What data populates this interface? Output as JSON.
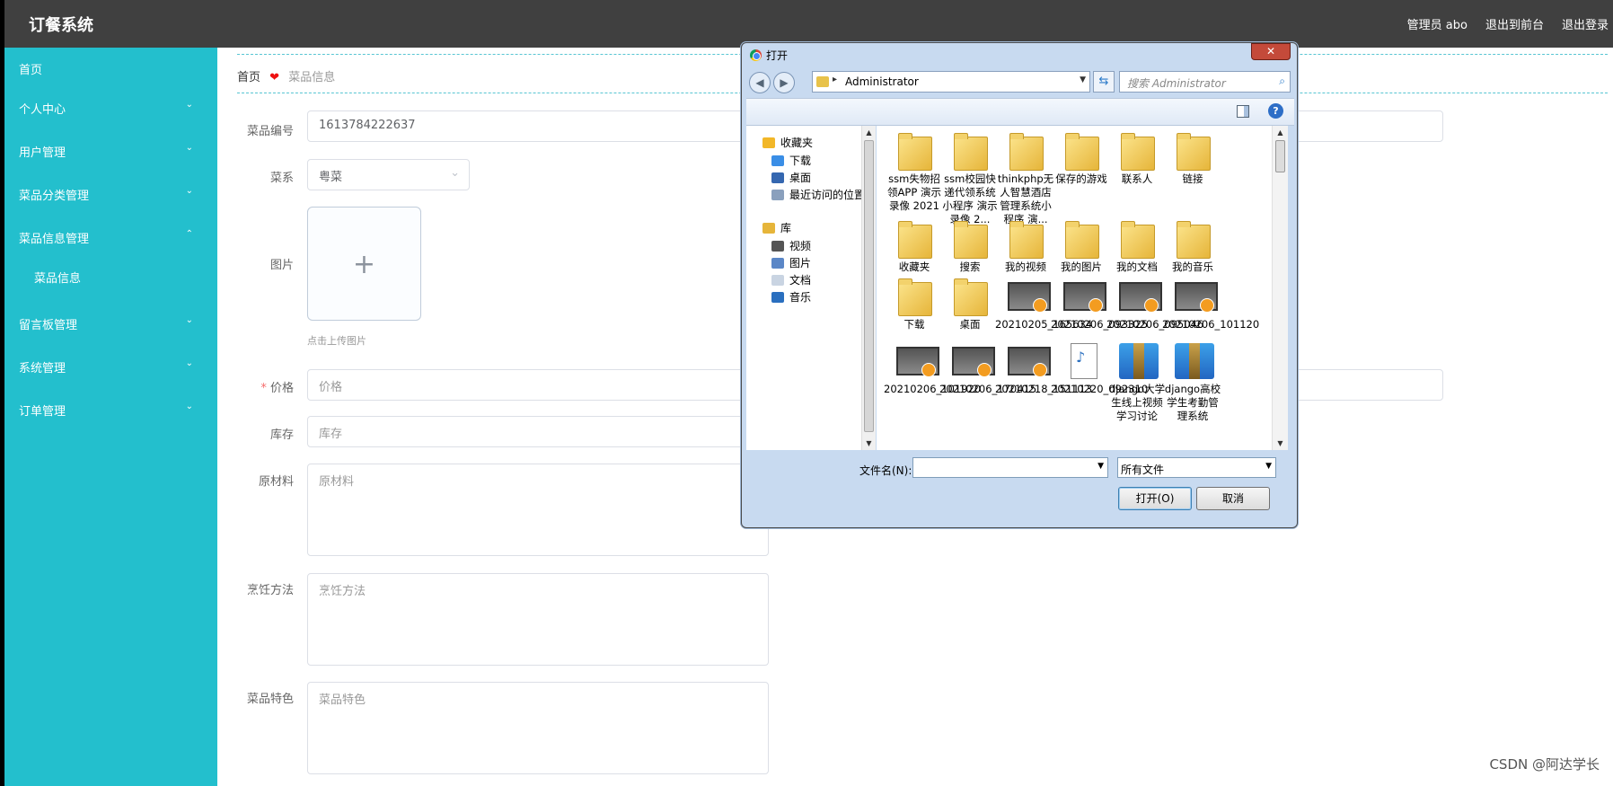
{
  "app": {
    "brand": "订餐系统",
    "topnav": [
      "管理员 abo",
      "退出到前台",
      "退出登录"
    ]
  },
  "sidebar": {
    "items": [
      {
        "label": "首页",
        "chevron": ""
      },
      {
        "label": "个人中心",
        "chevron": "⌄"
      },
      {
        "label": "用户管理",
        "chevron": "⌄"
      },
      {
        "label": "菜品分类管理",
        "chevron": "⌄"
      },
      {
        "label": "菜品信息管理",
        "chevron": "⌃"
      },
      {
        "label": "菜品信息",
        "chevron": ""
      },
      {
        "label": "留言板管理",
        "chevron": "⌄"
      },
      {
        "label": "系统管理",
        "chevron": "⌄"
      },
      {
        "label": "订单管理",
        "chevron": "⌄"
      }
    ]
  },
  "breadcrumb": {
    "home": "首页",
    "sep": "❤",
    "current": "菜品信息"
  },
  "form": {
    "code_label": "菜品编号",
    "code_value": "1613784222637",
    "cuisine_label": "菜系",
    "cuisine_value": "粤菜",
    "cuisine_dd": "⌄",
    "image_label": "图片",
    "upload_plus": "+",
    "upload_hint": "点击上传图片",
    "price_req": "*",
    "price_label": "价格",
    "price_placeholder": "价格",
    "stock_label": "库存",
    "stock_placeholder": "库存",
    "material_label": "原材料",
    "material_placeholder": "原材料",
    "method_label": "烹饪方法",
    "method_placeholder": "烹饪方法",
    "feature_label": "菜品特色",
    "feature_placeholder": "菜品特色"
  },
  "watermark": "CSDN @阿达学长",
  "dialog": {
    "title": "打开",
    "close": "✕",
    "back": "◀",
    "forward": "▶",
    "address": "Administrator",
    "address_arrow": "▸",
    "dropdown": "▼",
    "refresh": "⇆",
    "search_placeholder": "搜索 Administrator",
    "search_icon": "⌕",
    "help": "?",
    "scroll_up": "▲",
    "scroll_down": "▼",
    "nav": [
      {
        "label": "收藏夹",
        "icon": "star-icon",
        "color": "#f2b728"
      },
      {
        "label": "下载",
        "icon": "download-folder-icon",
        "color": "#3a8ee6"
      },
      {
        "label": "桌面",
        "icon": "desktop-icon",
        "color": "#3567b0"
      },
      {
        "label": "最近访问的位置",
        "icon": "recent-places-icon",
        "color": "#8aa0bd"
      },
      {
        "label": "库",
        "icon": "library-icon",
        "color": "#e6b53a"
      },
      {
        "label": "视频",
        "icon": "video-library-icon",
        "color": "#555555"
      },
      {
        "label": "图片",
        "icon": "pictures-library-icon",
        "color": "#5b87c7"
      },
      {
        "label": "文档",
        "icon": "documents-library-icon",
        "color": "#c9d4e2"
      },
      {
        "label": "音乐",
        "icon": "music-library-icon",
        "color": "#2a6fbf"
      }
    ],
    "files": [
      {
        "name": "ssm失物招领APP 演示录像 2021",
        "kind": "folder"
      },
      {
        "name": "ssm校园快递代领系统小程序 演示录像 2...",
        "kind": "folder"
      },
      {
        "name": "thinkphp无人智慧酒店管理系统小程序 演...",
        "kind": "folder"
      },
      {
        "name": "保存的游戏",
        "kind": "folder"
      },
      {
        "name": "联系人",
        "kind": "folder"
      },
      {
        "name": "链接",
        "kind": "folder"
      },
      {
        "name": "收藏夹",
        "kind": "folder"
      },
      {
        "name": "搜索",
        "kind": "folder"
      },
      {
        "name": "我的视频",
        "kind": "folder"
      },
      {
        "name": "我的图片",
        "kind": "folder"
      },
      {
        "name": "我的文档",
        "kind": "folder"
      },
      {
        "name": "我的音乐",
        "kind": "folder"
      },
      {
        "name": "下载",
        "kind": "folder"
      },
      {
        "name": "桌面",
        "kind": "folder"
      },
      {
        "name": "20210205_165634",
        "kind": "video"
      },
      {
        "name": "20210206_093325",
        "kind": "video"
      },
      {
        "name": "20210206_095046",
        "kind": "video"
      },
      {
        "name": "20210206_101120",
        "kind": "video"
      },
      {
        "name": "20210206_101920",
        "kind": "video"
      },
      {
        "name": "20210206_170415",
        "kind": "video"
      },
      {
        "name": "20210218_151113",
        "kind": "video"
      },
      {
        "name": "20210220_092310",
        "kind": "doc"
      },
      {
        "name": "django大学生线上视频学习讨论",
        "kind": "archive"
      },
      {
        "name": "django高校学生考勤管理系统",
        "kind": "archive"
      }
    ],
    "filename_label": "文件名(N):",
    "filetype": "所有文件",
    "open_btn": "打开(O)",
    "cancel_btn": "取消"
  }
}
